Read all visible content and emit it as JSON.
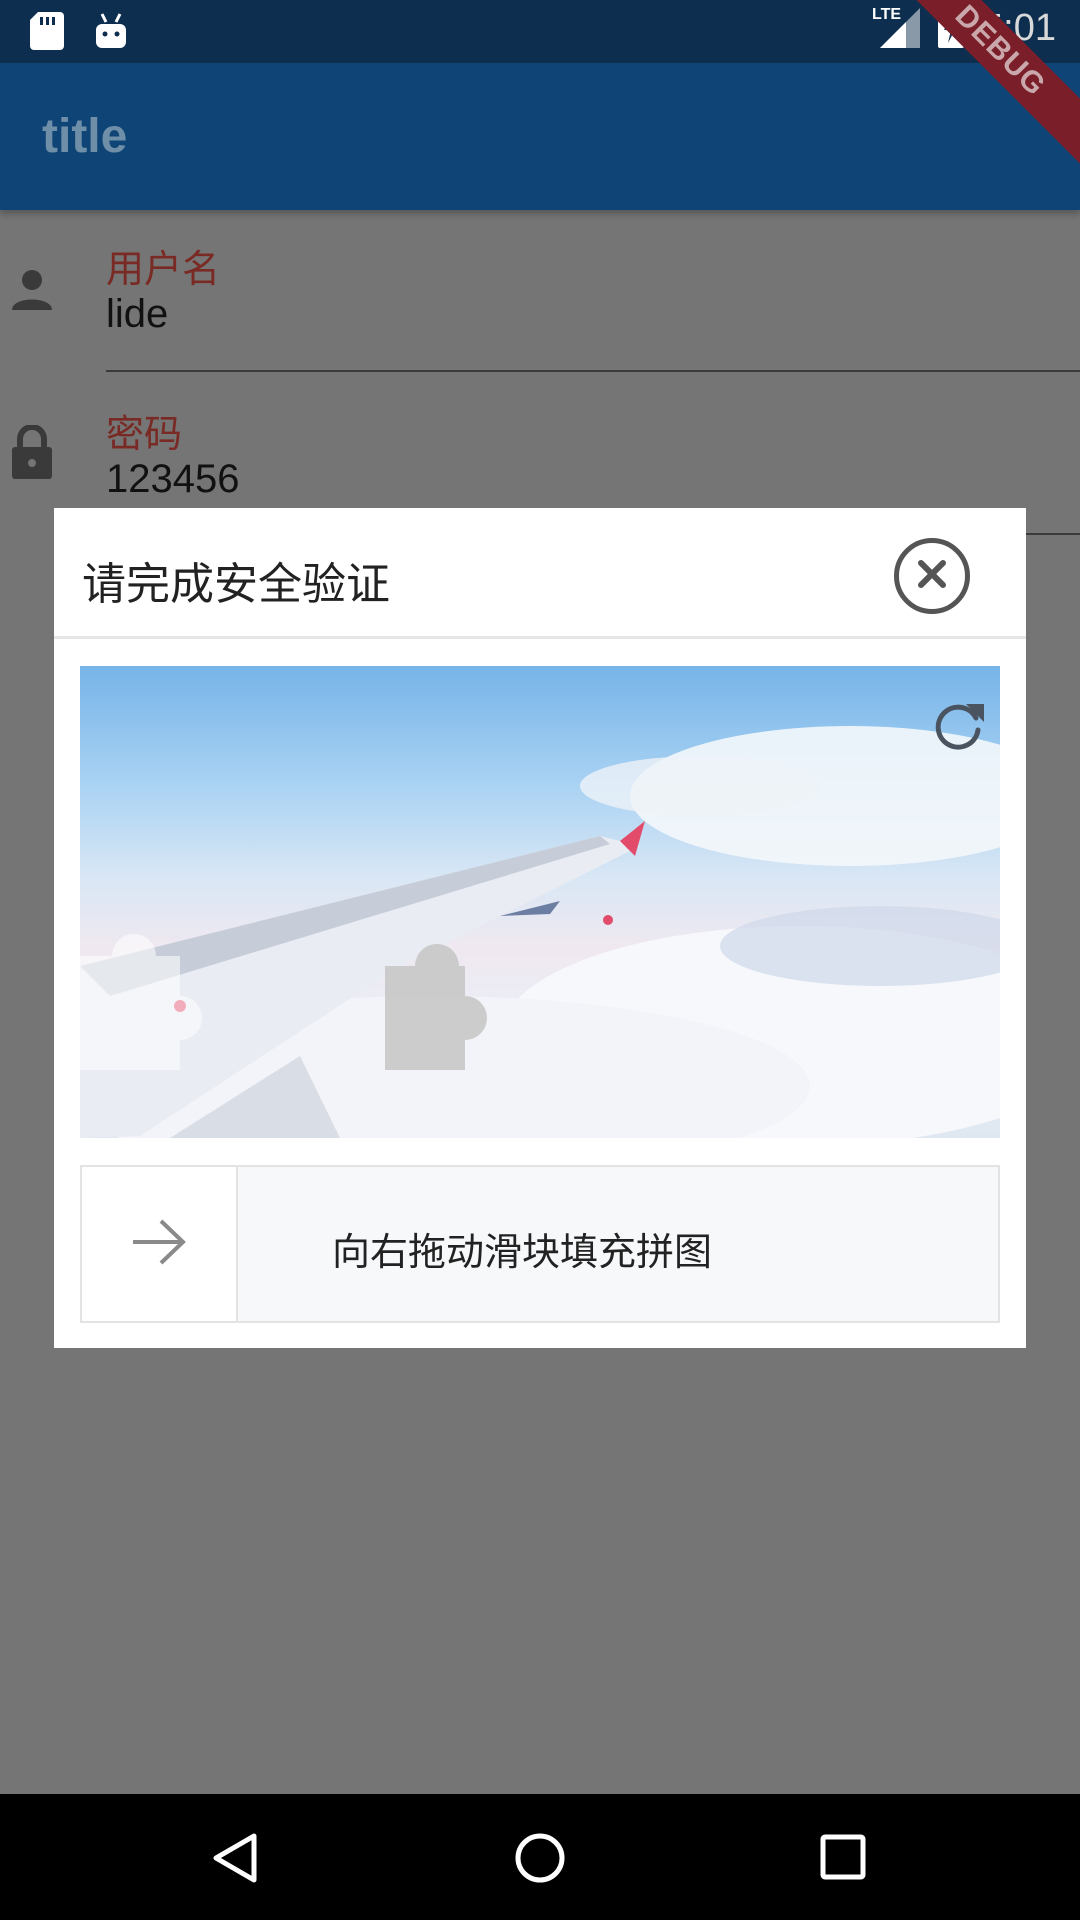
{
  "status_bar": {
    "time": "5:01",
    "network": "LTE",
    "icons": [
      "sd-card-icon",
      "android-icon",
      "signal-icon",
      "battery-charging-icon"
    ]
  },
  "debug_banner": "DEBUG",
  "app_bar": {
    "title": "title"
  },
  "form": {
    "username": {
      "label": "用户名",
      "value": "lide",
      "icon": "person-icon"
    },
    "password": {
      "label": "密码",
      "value": "123456",
      "icon": "lock-icon"
    }
  },
  "dialog": {
    "title": "请完成安全验证",
    "close_icon": "close-circle-icon",
    "refresh_icon": "refresh-icon",
    "slider_text": "向右拖动滑块填充拼图",
    "slider_icon": "arrow-right-icon"
  },
  "nav_bar": {
    "icons": [
      "back-icon",
      "home-icon",
      "recents-icon"
    ]
  },
  "colors": {
    "app_bar": "#0f4576",
    "status_bar": "#0d2e4e",
    "label": "#7a2a24",
    "scrim": "#757575"
  }
}
